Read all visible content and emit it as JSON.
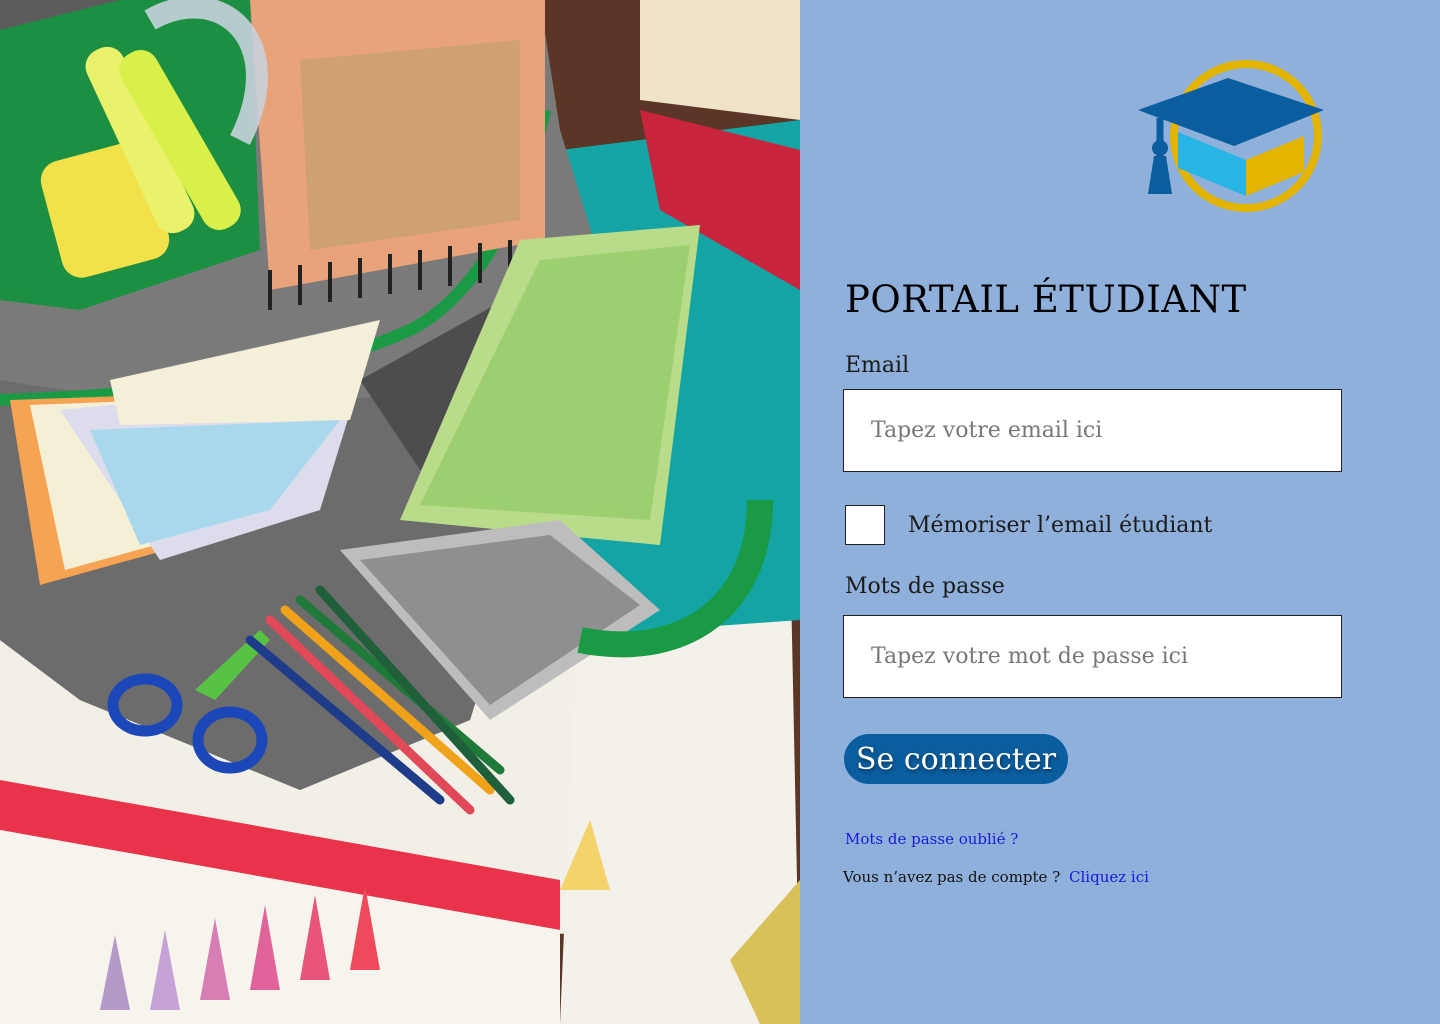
{
  "photo": {
    "subject": "school-supplies-backpack"
  },
  "logo": {
    "icon": "graduation-cap-icon",
    "colors": {
      "cap": "#0a5d9e",
      "ring": "#e3b400",
      "box_light": "#29b4e6",
      "box_dark": "#e3b400"
    }
  },
  "form": {
    "title": "PORTAIL ÉTUDIANT",
    "email_label": "Email",
    "email_placeholder": "Tapez votre email ici",
    "remember_label": "Mémoriser l’email étudiant",
    "password_label": "Mots de passe",
    "password_placeholder": "Tapez votre mot de passe ici",
    "submit_label": "Se connecter",
    "forgot_link": "Mots de passe oublié ?",
    "signup_text": "Vous n’avez pas de compte ?",
    "signup_link": "Cliquez ici"
  },
  "colors": {
    "panel_bg": "#8fb0da",
    "button_bg": "#0a5d9e",
    "link": "#1a1adc"
  }
}
